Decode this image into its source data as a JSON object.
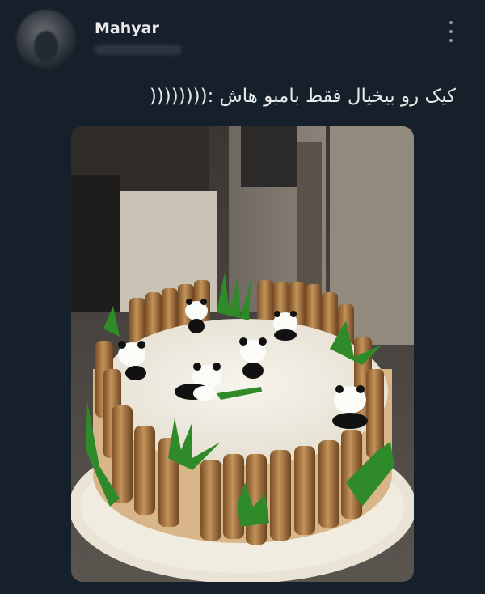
{
  "tweet": {
    "author_name": "Mahyar",
    "text": "کیک رو بیخیال فقط بامبو هاش :((((((((",
    "menu_icon": "more-vertical-icon",
    "avatar_icon": "avatar"
  },
  "media": {
    "description_icon": "cake-photo",
    "subject": "panda cake"
  },
  "colors": {
    "background": "#15202b",
    "text": "#e7e9ea",
    "muted": "#8b98a5"
  }
}
